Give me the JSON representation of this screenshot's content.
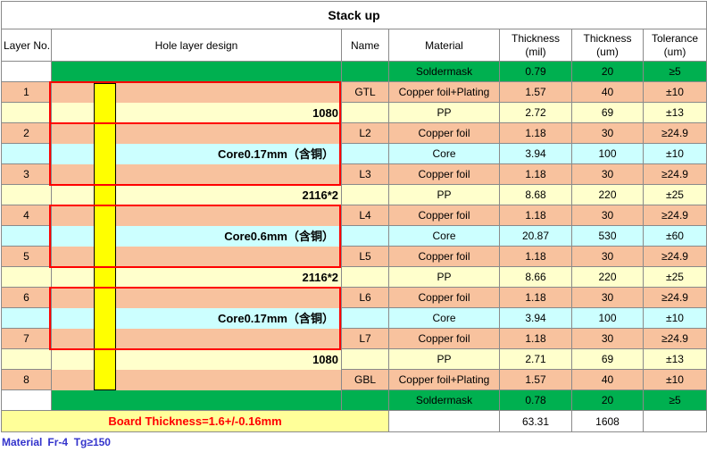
{
  "title": "Stack up",
  "headers": {
    "layer_no": "Layer No.",
    "hole_design": "Hole layer design",
    "name": "Name",
    "material": "Material",
    "thickness_mil_line1": "Thickness",
    "thickness_mil_line2": "(mil)",
    "thickness_um_line1": "Thickness",
    "thickness_um_line2": "(um)",
    "tolerance_line1": "Tolerance",
    "tolerance_line2": "(um)"
  },
  "rows": [
    {
      "layer": "",
      "hole": "",
      "name": "",
      "material": "Soldermask",
      "mil": "0.79",
      "um": "20",
      "tol": "≥5",
      "color": "#00b050"
    },
    {
      "layer": "1",
      "hole": "",
      "name": "GTL",
      "material": "Copper foil+Plating",
      "mil": "1.57",
      "um": "40",
      "tol": "±10",
      "color": "#f8c29e"
    },
    {
      "layer": "",
      "hole": "1080",
      "name": "",
      "material": "PP",
      "mil": "2.72",
      "um": "69",
      "tol": "±13",
      "color": "#ffffcc"
    },
    {
      "layer": "2",
      "hole": "",
      "name": "L2",
      "material": "Copper foil",
      "mil": "1.18",
      "um": "30",
      "tol": "≥24.9",
      "color": "#f8c29e"
    },
    {
      "layer": "",
      "hole": "Core0.17mm（含铜）",
      "name": "",
      "material": "Core",
      "mil": "3.94",
      "um": "100",
      "tol": "±10",
      "color": "#ccffff"
    },
    {
      "layer": "3",
      "hole": "",
      "name": "L3",
      "material": "Copper foil",
      "mil": "1.18",
      "um": "30",
      "tol": "≥24.9",
      "color": "#f8c29e"
    },
    {
      "layer": "",
      "hole": "2116*2",
      "name": "",
      "material": "PP",
      "mil": "8.68",
      "um": "220",
      "tol": "±25",
      "color": "#ffffcc"
    },
    {
      "layer": "4",
      "hole": "",
      "name": "L4",
      "material": "Copper foil",
      "mil": "1.18",
      "um": "30",
      "tol": "≥24.9",
      "color": "#f8c29e"
    },
    {
      "layer": "",
      "hole": "Core0.6mm（含铜）",
      "name": "",
      "material": "Core",
      "mil": "20.87",
      "um": "530",
      "tol": "±60",
      "color": "#ccffff"
    },
    {
      "layer": "5",
      "hole": "",
      "name": "L5",
      "material": "Copper foil",
      "mil": "1.18",
      "um": "30",
      "tol": "≥24.9",
      "color": "#f8c29e"
    },
    {
      "layer": "",
      "hole": "2116*2",
      "name": "",
      "material": "PP",
      "mil": "8.66",
      "um": "220",
      "tol": "±25",
      "color": "#ffffcc"
    },
    {
      "layer": "6",
      "hole": "",
      "name": "L6",
      "material": "Copper foil",
      "mil": "1.18",
      "um": "30",
      "tol": "≥24.9",
      "color": "#f8c29e"
    },
    {
      "layer": "",
      "hole": "Core0.17mm（含铜）",
      "name": "",
      "material": "Core",
      "mil": "3.94",
      "um": "100",
      "tol": "±10",
      "color": "#ccffff"
    },
    {
      "layer": "7",
      "hole": "",
      "name": "L7",
      "material": "Copper foil",
      "mil": "1.18",
      "um": "30",
      "tol": "≥24.9",
      "color": "#f8c29e"
    },
    {
      "layer": "",
      "hole": "1080",
      "name": "",
      "material": "PP",
      "mil": "2.71",
      "um": "69",
      "tol": "±13",
      "color": "#ffffcc"
    },
    {
      "layer": "8",
      "hole": "",
      "name": "GBL",
      "material": "Copper foil+Plating",
      "mil": "1.57",
      "um": "40",
      "tol": "±10",
      "color": "#f8c29e"
    },
    {
      "layer": "",
      "hole": "",
      "name": "",
      "material": "Soldermask",
      "mil": "0.78",
      "um": "20",
      "tol": "≥5",
      "color": "#00b050"
    }
  ],
  "footer": {
    "board_thickness": "Board Thickness=1.6+/-0.16mm",
    "total_mil": "63.31",
    "total_um": "1608"
  },
  "material_row": {
    "label": "Material",
    "value": "Fr-4  Tg≥150"
  }
}
